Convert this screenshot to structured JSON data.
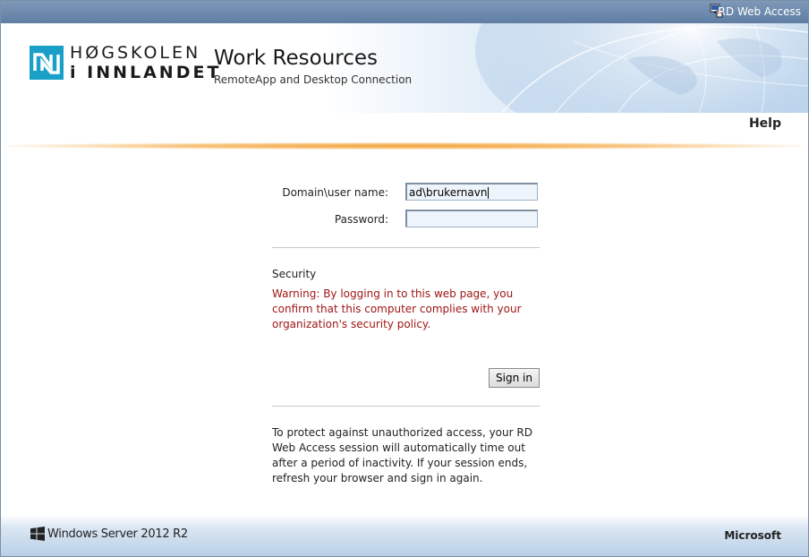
{
  "topbar": {
    "title": "RD Web Access",
    "icon": "rd-web-access-icon"
  },
  "header": {
    "logo_line1": "HØGSKOLEN",
    "logo_line2": "i INNLANDET",
    "title": "Work Resources",
    "subtitle": "RemoteApp and Desktop Connection"
  },
  "nav": {
    "help": "Help"
  },
  "form": {
    "username_label": "Domain\\user name:",
    "username_value": "ad\\brukernavn",
    "password_label": "Password:",
    "password_value": ""
  },
  "security": {
    "title": "Security",
    "warning": "Warning: By logging in to this web page, you confirm that this computer complies with your organization's security policy."
  },
  "signin_label": "Sign in",
  "info_text": "To protect against unauthorized access, your RD Web Access session will automatically time out after a period of inactivity. If your session ends, refresh your browser and sign in again.",
  "footer": {
    "product": "Windows Server 2012 R2",
    "vendor": "Microsoft"
  },
  "colors": {
    "topbar": "#6b88ac",
    "accent_orange": "#f3a33a",
    "warning_red": "#a01616",
    "logo_blue": "#1aa0c8"
  }
}
